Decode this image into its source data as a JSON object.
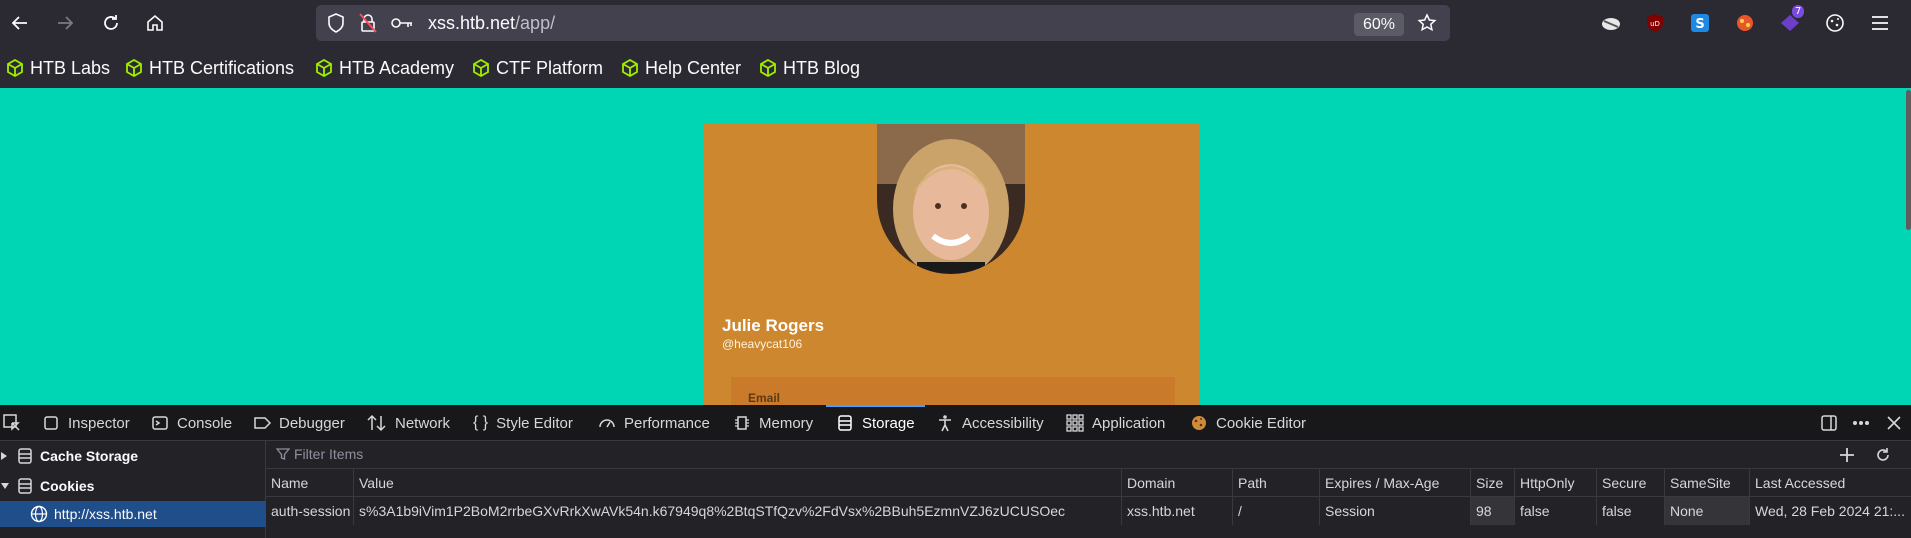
{
  "browser": {
    "url_host": "xss.htb.net",
    "url_path": "/app/",
    "zoom": "60%",
    "extension_badge": "7",
    "bookmarks": [
      "HTB Labs",
      "HTB Certifications",
      "HTB Academy",
      "CTF Platform",
      "Help Center",
      "HTB Blog"
    ]
  },
  "profile": {
    "name": "Julie Rogers",
    "handle": "@heavycat106",
    "email_label": "Email"
  },
  "devtools": {
    "tabs": [
      "Inspector",
      "Console",
      "Debugger",
      "Network",
      "Style Editor",
      "Performance",
      "Memory",
      "Storage",
      "Accessibility",
      "Application",
      "Cookie Editor"
    ],
    "active_tab": "Storage",
    "sidebar": {
      "cache_storage": "Cache Storage",
      "cookies": "Cookies",
      "cookie_host": "http://xss.htb.net"
    },
    "filter_placeholder": "Filter Items",
    "columns": [
      "Name",
      "Value",
      "Domain",
      "Path",
      "Expires / Max-Age",
      "Size",
      "HttpOnly",
      "Secure",
      "SameSite",
      "Last Accessed"
    ],
    "rows": [
      {
        "name": "auth-session",
        "value": "s%3A1b9iVim1P2BoM2rrbeGXvRrkXwAVk54n.k67949q8%2BtqSTfQzv%2FdVsx%2BBuh5EzmnVZJ6zUCUSOec",
        "domain": "xss.htb.net",
        "path": "/",
        "expires": "Session",
        "size": "98",
        "httponly": "false",
        "secure": "false",
        "samesite": "None",
        "last_accessed": "Wed, 28 Feb 2024 21:..."
      }
    ]
  },
  "colors": {
    "page_bg": "#00d5b4",
    "card_bg": "#cd872f",
    "chrome_bg": "#2b2a33",
    "devtools_bg": "#232327",
    "accent": "#45a1ff",
    "bookmark_icon": "#9fef00"
  }
}
